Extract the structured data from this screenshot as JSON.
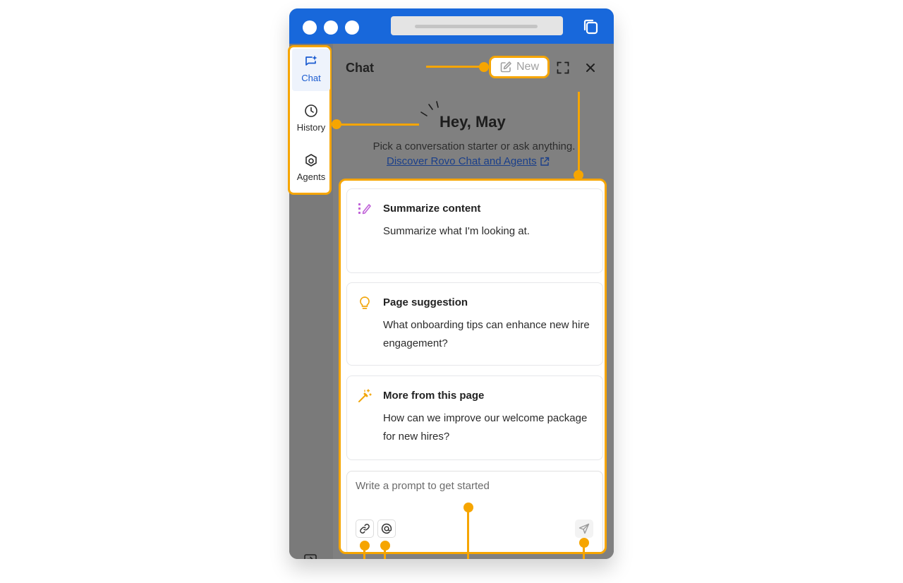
{
  "sidebar": {
    "items": [
      {
        "label": "Chat",
        "icon": "chat-sparkle-icon",
        "active": true
      },
      {
        "label": "History",
        "icon": "clock-icon",
        "active": false
      },
      {
        "label": "Agents",
        "icon": "agents-icon",
        "active": false
      }
    ]
  },
  "header": {
    "title": "Chat",
    "new_label": "New"
  },
  "greeting": {
    "title": "Hey, May",
    "subtitle": "Pick a conversation starter or ask anything.",
    "link_text": "Discover Rovo Chat and Agents"
  },
  "cards": [
    {
      "title": "Summarize content",
      "body": "Summarize what I'm looking at.",
      "icon": "summarize-icon",
      "color": "#c062d8"
    },
    {
      "title": "Page suggestion",
      "body": "What onboarding tips can enhance new hire engagement?",
      "icon": "lightbulb-icon",
      "color": "#f2a60b"
    },
    {
      "title": "More from this page",
      "body": "How can we improve our welcome package for new hires?",
      "icon": "magic-wand-icon",
      "color": "#f2a60b"
    }
  ],
  "prompt": {
    "placeholder": "Write a prompt to get started"
  },
  "colors": {
    "titlebar": "#1868db",
    "annotation": "#f6a500",
    "active_nav": "#1a5bd0"
  }
}
